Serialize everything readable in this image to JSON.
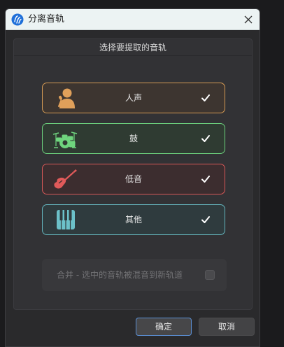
{
  "window": {
    "title": "分离音轨",
    "app_icon": "waveform-app-icon",
    "close_icon": "close-icon"
  },
  "panel": {
    "heading": "选择要提取的音轨"
  },
  "tracks": [
    {
      "id": "vocal",
      "label": "人声",
      "icon": "singer-icon",
      "color": "#d49a54",
      "checked": true
    },
    {
      "id": "drum",
      "label": "鼓",
      "icon": "drum-kit-icon",
      "color": "#6cd07d",
      "checked": true
    },
    {
      "id": "bass",
      "label": "低音",
      "icon": "bass-guitar-icon",
      "color": "#d65858",
      "checked": true
    },
    {
      "id": "other",
      "label": "其他",
      "icon": "piano-keys-icon",
      "color": "#64b4bc",
      "checked": true
    }
  ],
  "merge": {
    "label": "合并 - 选中的音轨被混音到新轨道",
    "checked": false,
    "enabled": false
  },
  "buttons": {
    "ok": "确定",
    "cancel": "取消"
  },
  "colors": {
    "accent_blue": "#5b8fd4",
    "title_bar": "#ecf3f3"
  }
}
